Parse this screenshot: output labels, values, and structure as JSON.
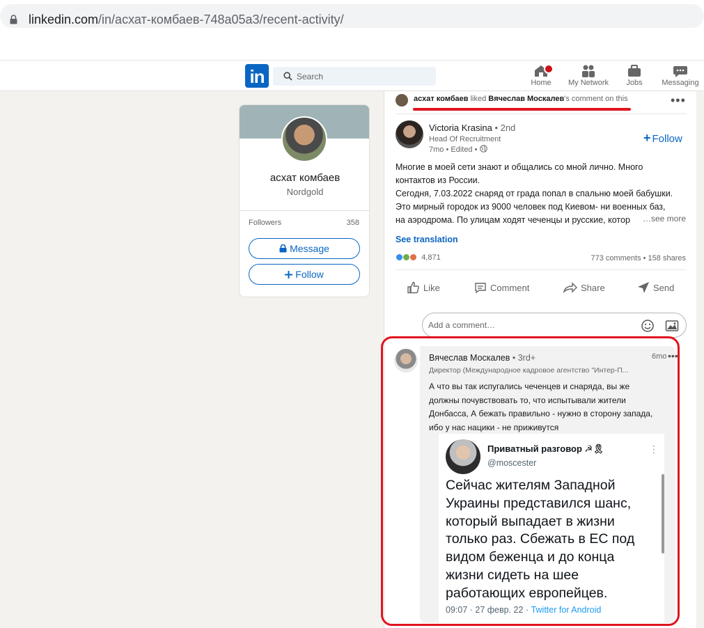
{
  "browser": {
    "url_host": "linkedin.com",
    "url_path": "/in/асхат-комбаев-748a05a3/recent-activity/"
  },
  "nav": {
    "logo": "in",
    "search_placeholder": "Search",
    "items": [
      {
        "label": "Home",
        "icon": "home-icon"
      },
      {
        "label": "My Network",
        "icon": "network-icon"
      },
      {
        "label": "Jobs",
        "icon": "briefcase-icon"
      },
      {
        "label": "Messaging",
        "icon": "messaging-icon"
      }
    ]
  },
  "profile": {
    "name": "асхат комбаев",
    "company": "Nordgold",
    "followers_label": "Followers",
    "followers_count": "358",
    "message_label": "Message",
    "follow_label": "Follow"
  },
  "activity": {
    "actor": "асхат комбаев",
    "verb": "liked",
    "target": "Вячеслав Москалев",
    "suffix": "'s comment on this"
  },
  "post": {
    "author": "Victoria Krasina",
    "degree": "• 2nd",
    "headline": "Head Of Recruitment",
    "meta": "7mo • Edited •",
    "follow_label": "Follow",
    "text_lines": [
      "Многие в моей сети знают и общались со мной лично. Много",
      "контактов из России.",
      "Сегодня, 7.03.2022 снаряд от града попал в спальню моей бабушки.",
      "Это мирный городок из 9000 человек под Киевом- ни военных баз,",
      "на аэродрома. По улицам ходят чеченцы и русские, котор"
    ],
    "see_more": "…see more",
    "see_translation": "See translation",
    "reactions_count": "4,871",
    "stats": "773 comments • 158 shares",
    "actions": {
      "like": "Like",
      "comment": "Comment",
      "share": "Share",
      "send": "Send"
    },
    "comment_placeholder": "Add a comment…"
  },
  "comment": {
    "author": "Вячеслав Москалев",
    "degree": "• 3rd+",
    "headline": "Директор (Международное кадровое агентство \"Интер-П...",
    "time": "6mo",
    "text_lines": [
      "А что вы так испугались чеченцев и снаряда, вы же",
      "должны почувствовать то, что испытывали жители",
      "Донбасса, А бежать правильно - нужно в сторону запада,",
      "ибо у нас нацики - не приживутся"
    ]
  },
  "tweet": {
    "name": "Приватный разговор ☭🎗",
    "handle": "@moscester",
    "text_lines": [
      "Сейчас жителям Западной",
      "Украины представился шанс,",
      "который выпадает в жизни",
      "только раз. Сбежать в ЕС под",
      "видом беженца и до конца",
      "жизни сидеть на шее",
      "работающих европейцев."
    ],
    "timestamp": "09:07 · 27 февр. 22 ·",
    "source": "Twitter for Android"
  },
  "colors": {
    "linkedin_blue": "#0a66c2",
    "highlight_red": "#e0141e",
    "twitter_blue": "#1d9bf0"
  }
}
